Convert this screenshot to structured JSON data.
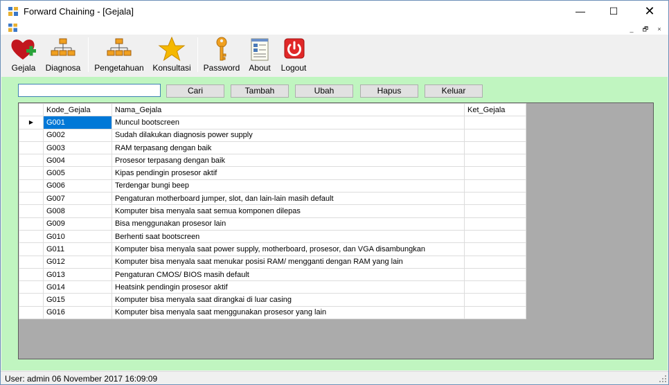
{
  "window": {
    "title": "Forward Chaining - [Gejala]",
    "controls": {
      "minimize": "—",
      "maximize": "☐",
      "close": "✕"
    }
  },
  "mdi": {
    "minimize": "_",
    "restore": "🗗",
    "close": "×"
  },
  "toolbar": {
    "items": [
      {
        "label": "Gejala",
        "icon": "heart-plus-icon"
      },
      {
        "label": "Diagnosa",
        "icon": "hierarchy-icon"
      },
      {
        "label": "Pengetahuan",
        "icon": "hierarchy-icon"
      },
      {
        "label": "Konsultasi",
        "icon": "star-icon"
      },
      {
        "label": "Password",
        "icon": "key-icon"
      },
      {
        "label": "About",
        "icon": "document-icon"
      },
      {
        "label": "Logout",
        "icon": "power-icon"
      }
    ]
  },
  "search": {
    "value": "",
    "placeholder": ""
  },
  "buttons": {
    "cari": "Cari",
    "tambah": "Tambah",
    "ubah": "Ubah",
    "hapus": "Hapus",
    "keluar": "Keluar"
  },
  "grid": {
    "columns": [
      "Kode_Gejala",
      "Nama_Gejala",
      "Ket_Gejala"
    ],
    "current_row_marker": "▶",
    "rows": [
      {
        "kode": "G001",
        "nama": "Muncul bootscreen",
        "ket": ""
      },
      {
        "kode": "G002",
        "nama": "Sudah dilakukan diagnosis power supply",
        "ket": ""
      },
      {
        "kode": "G003",
        "nama": "RAM terpasang dengan baik",
        "ket": ""
      },
      {
        "kode": "G004",
        "nama": "Prosesor terpasang dengan baik",
        "ket": ""
      },
      {
        "kode": "G005",
        "nama": "Kipas pendingin prosesor aktif",
        "ket": ""
      },
      {
        "kode": "G006",
        "nama": "Terdengar bungi beep",
        "ket": ""
      },
      {
        "kode": "G007",
        "nama": "Pengaturan motherboard jumper, slot, dan lain-lain masih default",
        "ket": ""
      },
      {
        "kode": "G008",
        "nama": "Komputer bisa menyala saat semua komponen dilepas",
        "ket": ""
      },
      {
        "kode": "G009",
        "nama": "Bisa menggunakan prosesor lain",
        "ket": ""
      },
      {
        "kode": "G010",
        "nama": "Berhenti saat bootscreen",
        "ket": ""
      },
      {
        "kode": "G011",
        "nama": "Komputer bisa menyala saat power supply, motherboard, prosesor, dan VGA disambungkan",
        "ket": ""
      },
      {
        "kode": "G012",
        "nama": "Komputer bisa menyala saat menukar posisi RAM/ mengganti dengan RAM yang lain",
        "ket": ""
      },
      {
        "kode": "G013",
        "nama": "Pengaturan CMOS/ BIOS masih default",
        "ket": ""
      },
      {
        "kode": "G014",
        "nama": "Heatsink pendingin prosesor aktif",
        "ket": ""
      },
      {
        "kode": "G015",
        "nama": "Komputer bisa menyala saat dirangkai di luar casing",
        "ket": ""
      },
      {
        "kode": "G016",
        "nama": "Komputer bisa menyala saat menggunakan prosesor yang lain",
        "ket": ""
      }
    ]
  },
  "status": {
    "text": "User: admin  06 November 2017 16:09:09"
  },
  "colors": {
    "panel": "#c0f5c0",
    "selection": "#0078d7",
    "grid_bg": "#ababab"
  }
}
